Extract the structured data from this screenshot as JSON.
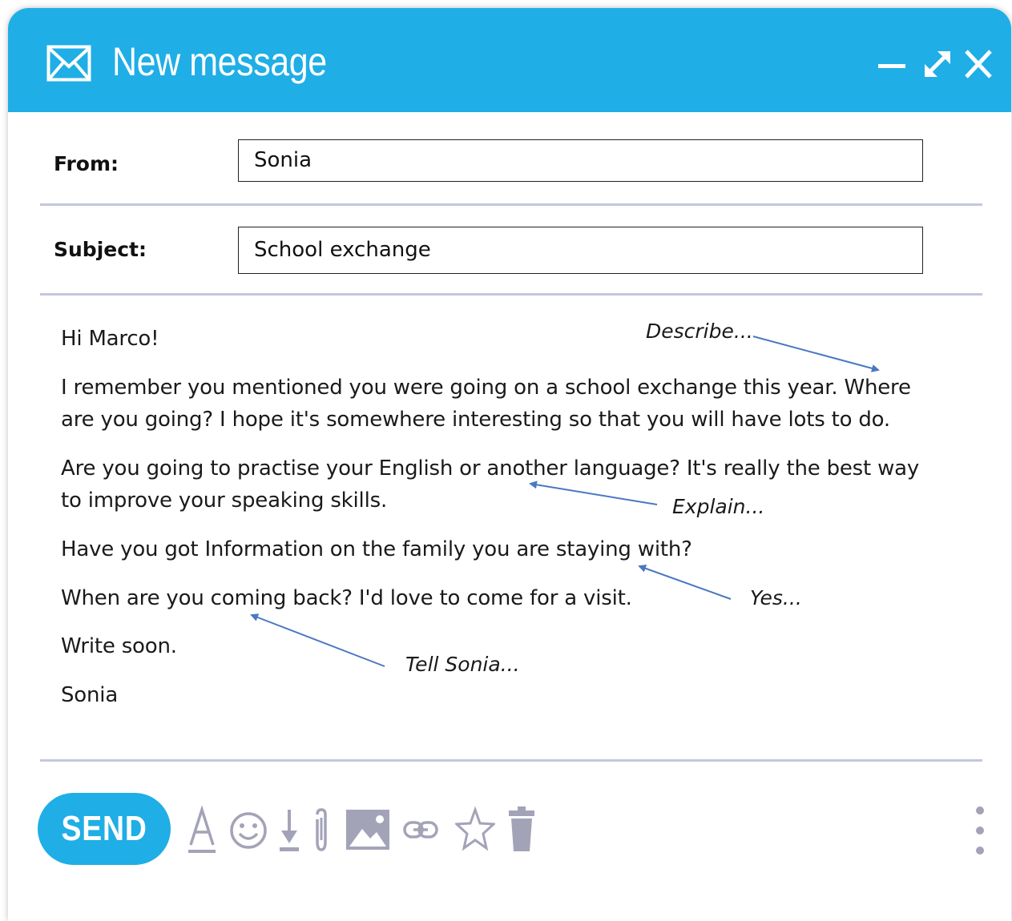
{
  "window": {
    "title": "New message",
    "title_icon": "envelope-icon",
    "controls": [
      "minimize-icon",
      "expand-icon",
      "close-icon"
    ]
  },
  "fields": {
    "from_label": "From:",
    "from_value": "Sonia",
    "subject_label": "Subject:",
    "subject_value": "School exchange"
  },
  "message": {
    "greeting": "Hi Marco!",
    "p1_line1": "I remember you mentioned you were going on a school exchange this year. Where",
    "p1_line2": "are you going? I hope it's somewhere interesting so that you will have lots to do.",
    "p2_line1": "Are you going to practise your English or another language? It's really the best way",
    "p2_line2": "to improve your speaking skills.",
    "p3": "Have you got Information on the family you are staying with?",
    "p4": "When are you coming back? I'd love to come for a visit.",
    "closing": "Write soon.",
    "signature": "Sonia"
  },
  "annotations": {
    "describe": "Describe...",
    "explain": "Explain...",
    "yes": "Yes...",
    "tell": "Tell Sonia..."
  },
  "toolbar": {
    "send_label": "SEND",
    "icons": [
      "text-format-icon",
      "emoji-icon",
      "download-icon",
      "attachment-icon",
      "image-icon",
      "link-icon",
      "star-icon",
      "trash-icon",
      "more-options-icon"
    ]
  },
  "colors": {
    "accent": "#1faee6",
    "toolbar_icon": "#a3a3b8",
    "divider": "#c4c6df",
    "arrow": "#4a78c2"
  }
}
